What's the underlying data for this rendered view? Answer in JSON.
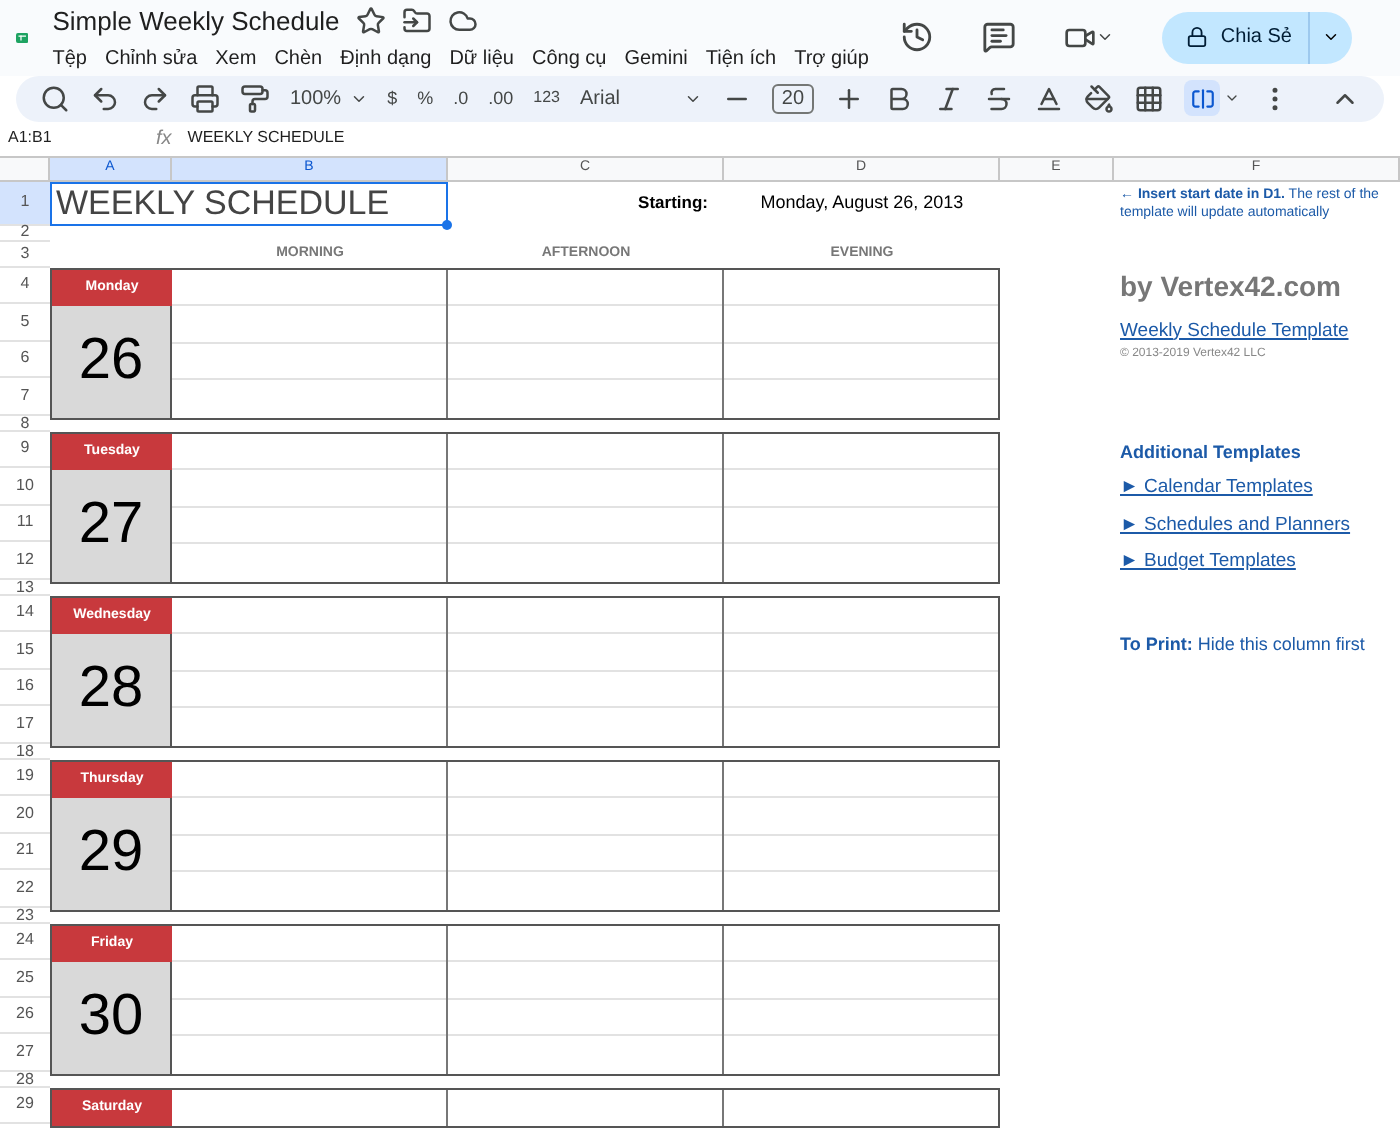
{
  "app": {
    "title": "Simple Weekly Schedule",
    "menu": [
      "Tệp",
      "Chỉnh sửa",
      "Xem",
      "Chèn",
      "Định dạng",
      "Dữ liệu",
      "Công cụ",
      "Gemini",
      "Tiện ích",
      "Trợ giúp"
    ],
    "share_button": "Chia Sẻ"
  },
  "toolbar": {
    "zoom": "100%",
    "currency": "$",
    "percent": "%",
    "decrease_decimals": ".0",
    "increase_decimals": ".00",
    "number_format": "123",
    "font": "Arial",
    "font_size": "20",
    "merge_selected": true
  },
  "formula_bar": {
    "cell_ref": "A1:B1",
    "fx": "fx",
    "value": "WEEKLY SCHEDULE"
  },
  "columns": [
    {
      "label": "A",
      "selected": true
    },
    {
      "label": "B",
      "selected": true
    },
    {
      "label": "C",
      "selected": false
    },
    {
      "label": "D",
      "selected": false
    },
    {
      "label": "E",
      "selected": false
    },
    {
      "label": "F",
      "selected": false
    }
  ],
  "sheet": {
    "title": "WEEKLY SCHEDULE",
    "header_rows": [
      {
        "number": "1",
        "selected": true
      },
      {
        "number": "2",
        "selected": false
      },
      {
        "number": "3",
        "selected": false
      }
    ],
    "starting_label": "Starting:",
    "starting_date": "Monday, August 26, 2013",
    "periods": [
      "MORNING",
      "AFTERNOON",
      "EVENING"
    ],
    "days": [
      {
        "name": "Monday",
        "date": "26",
        "rows": [
          "4",
          "5",
          "6",
          "7"
        ],
        "gap_row": "8"
      },
      {
        "name": "Tuesday",
        "date": "27",
        "rows": [
          "9",
          "10",
          "11",
          "12"
        ],
        "gap_row": "13"
      },
      {
        "name": "Wednesday",
        "date": "28",
        "rows": [
          "14",
          "15",
          "16",
          "17"
        ],
        "gap_row": "18"
      },
      {
        "name": "Thursday",
        "date": "29",
        "rows": [
          "19",
          "20",
          "21",
          "22"
        ],
        "gap_row": "23"
      },
      {
        "name": "Friday",
        "date": "30",
        "rows": [
          "24",
          "25",
          "26",
          "27"
        ],
        "gap_row": "28"
      },
      {
        "name": "Saturday",
        "rows": [
          "29"
        ]
      }
    ]
  },
  "side_notes": {
    "hint_bold": "← Insert start date in D1.",
    "hint_rest": " The rest of the template will update automatically",
    "brand": "by Vertex42.com",
    "template_link": "Weekly Schedule Template",
    "copyright": "© 2013-2019 Vertex42 LLC",
    "additional_heading": "Additional Templates",
    "links": [
      "► Calendar Templates",
      "► Schedules and Planners",
      "► Budget Templates"
    ],
    "print_label": "To Print:",
    "print_note": " Hide this column first"
  }
}
